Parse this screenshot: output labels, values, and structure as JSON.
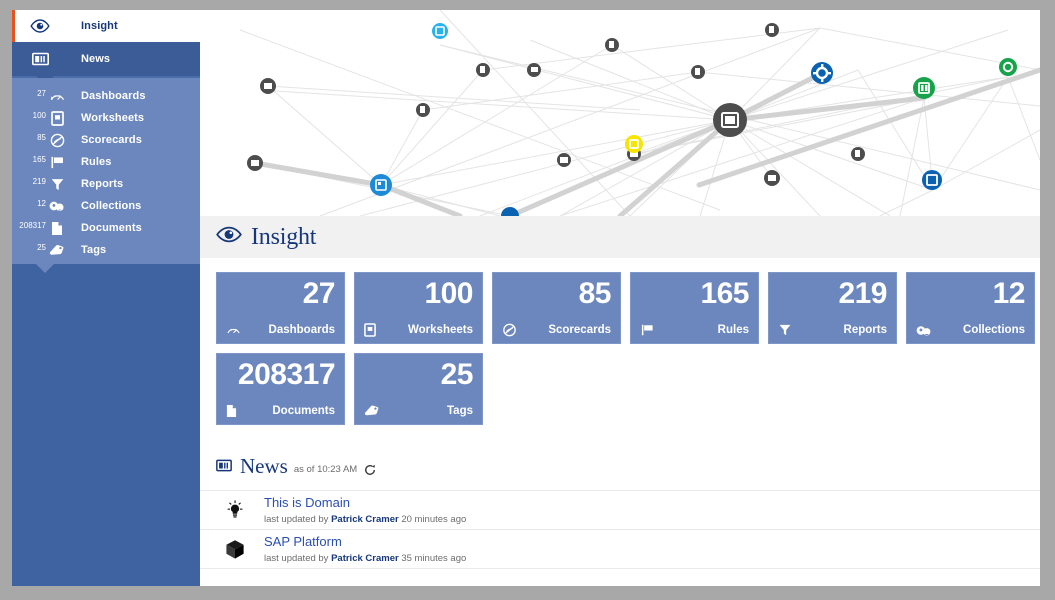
{
  "app": {
    "background_color": "#a8a8a8",
    "accent_color": "#e8521f",
    "brand_blue": "#16377a",
    "tile_color": "#6b87bd",
    "sidebar_color": "#4a6ea9"
  },
  "sidebar": {
    "top_item": {
      "label": "Insight",
      "icon": "eye-icon"
    },
    "active_item": {
      "label": "News",
      "icon": "news-board-icon"
    },
    "items": [
      {
        "count": "27",
        "label": "Dashboards",
        "icon": "gauge-icon"
      },
      {
        "count": "100",
        "label": "Worksheets",
        "icon": "worksheet-icon"
      },
      {
        "count": "85",
        "label": "Scorecards",
        "icon": "scorecard-icon"
      },
      {
        "count": "165",
        "label": "Rules",
        "icon": "flag-icon"
      },
      {
        "count": "219",
        "label": "Reports",
        "icon": "funnel-icon"
      },
      {
        "count": "12",
        "label": "Collections",
        "icon": "collection-icon"
      },
      {
        "count": "208317",
        "label": "Documents",
        "icon": "document-icon"
      },
      {
        "count": "25",
        "label": "Tags",
        "icon": "tag-icon"
      }
    ]
  },
  "header": {
    "title": "Insight",
    "icon": "eye-icon"
  },
  "tiles": [
    {
      "value": "27",
      "label": "Dashboards",
      "icon": "gauge-icon"
    },
    {
      "value": "100",
      "label": "Worksheets",
      "icon": "worksheet-icon"
    },
    {
      "value": "85",
      "label": "Scorecards",
      "icon": "scorecard-icon"
    },
    {
      "value": "165",
      "label": "Rules",
      "icon": "flag-icon"
    },
    {
      "value": "219",
      "label": "Reports",
      "icon": "funnel-icon"
    },
    {
      "value": "12",
      "label": "Collections",
      "icon": "collection-icon"
    },
    {
      "value": "208317",
      "label": "Documents",
      "icon": "document-icon"
    },
    {
      "value": "25",
      "label": "Tags",
      "icon": "tag-icon"
    }
  ],
  "news": {
    "title": "News",
    "icon": "news-board-icon",
    "as_of": "as of 10:23 AM",
    "refresh_icon": "refresh-icon",
    "items": [
      {
        "icon": "lightbulb-icon",
        "title": "This is Domain",
        "prefix": "last updated by ",
        "author": "Patrick Cramer",
        "suffix": " 20 minutes ago"
      },
      {
        "icon": "cube-icon",
        "title": "SAP Platform",
        "prefix": "last updated by ",
        "author": "Patrick Cramer",
        "suffix": " 35 minutes ago"
      }
    ]
  },
  "graph": {
    "node_colors": {
      "default": "#4d4d4d",
      "blue": "#1c8ad6",
      "light_blue": "#2ab0ea",
      "dark_blue": "#0a62b0",
      "green": "#16a34a",
      "yellow": "#f5e500"
    }
  }
}
